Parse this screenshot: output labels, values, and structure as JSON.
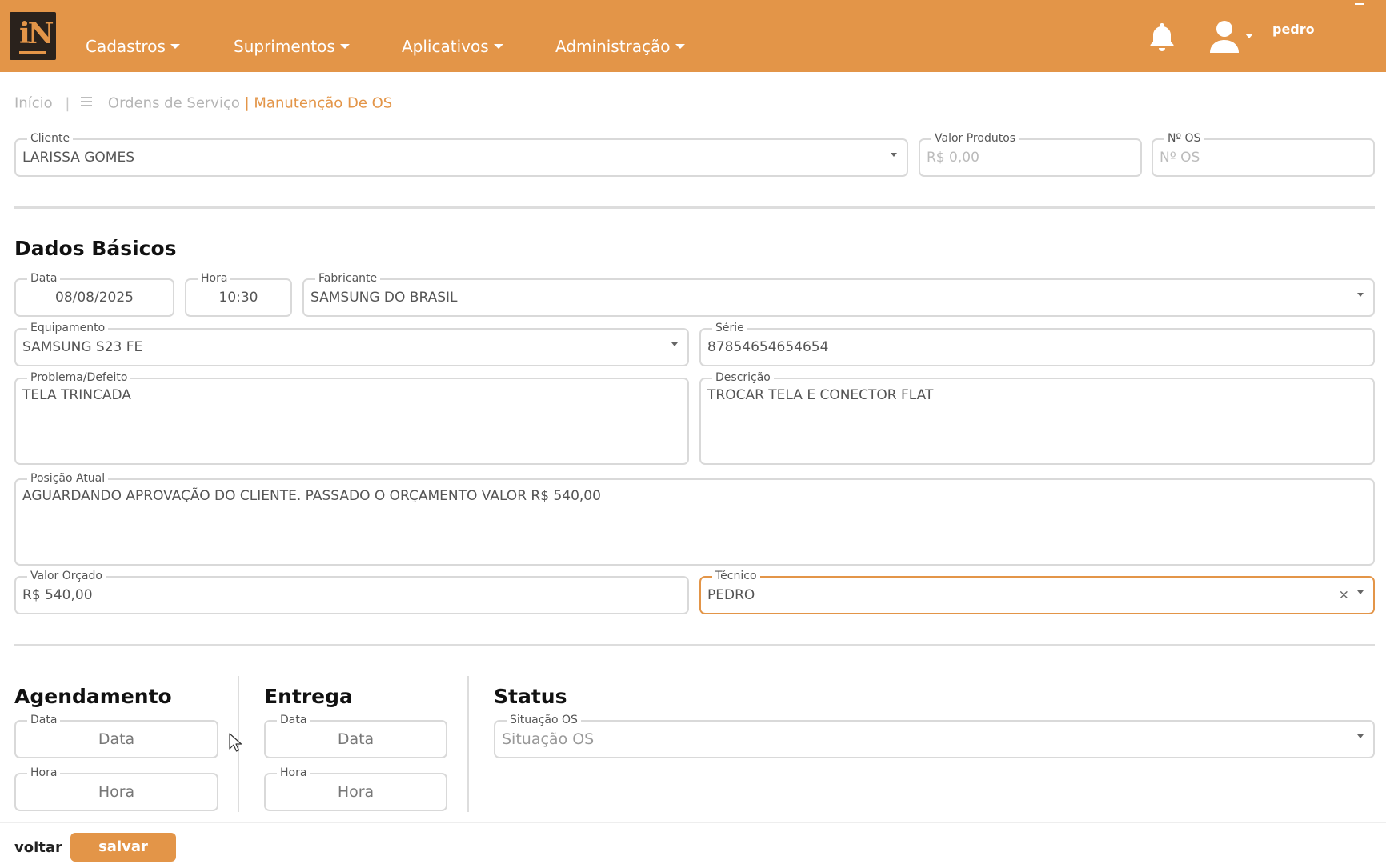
{
  "navbar": {
    "logo_text": "iN",
    "menu": [
      {
        "label": "Cadastros"
      },
      {
        "label": "Suprimentos"
      },
      {
        "label": "Aplicativos"
      },
      {
        "label": "Administração"
      }
    ],
    "username": "pedro",
    "accent_color": "#e39548"
  },
  "breadcrumb": {
    "home": "Início",
    "separator": "|",
    "list": "Ordens de Serviço",
    "current": "| Manutenção De OS"
  },
  "header_fields": {
    "cliente": {
      "label": "Cliente",
      "value": "LARISSA GOMES"
    },
    "valor_produtos": {
      "label": "Valor Produtos",
      "placeholder": "R$ 0,00"
    },
    "numero_os": {
      "label": "Nº OS",
      "placeholder": "Nº OS"
    }
  },
  "dados_basicos": {
    "title": "Dados Básicos",
    "data": {
      "label": "Data",
      "value": "08/08/2025"
    },
    "hora": {
      "label": "Hora",
      "value": "10:30"
    },
    "fabricante": {
      "label": "Fabricante",
      "value": "SAMSUNG DO BRASIL"
    },
    "equipamento": {
      "label": "Equipamento",
      "value": "SAMSUNG S23 FE"
    },
    "serie": {
      "label": "Série",
      "value": "87854654654654"
    },
    "problema": {
      "label": "Problema/Defeito",
      "value": "TELA TRINCADA"
    },
    "descricao": {
      "label": "Descrição",
      "value": "TROCAR TELA E CONECTOR FLAT"
    },
    "posicao_atual": {
      "label": "Posição Atual",
      "value": "AGUARDANDO APROVAÇÃO DO CLIENTE. PASSADO O ORÇAMENTO VALOR R$ 540,00"
    },
    "valor_orcado": {
      "label": "Valor Orçado",
      "value": "R$ 540,00"
    },
    "tecnico": {
      "label": "Técnico",
      "value": "PEDRO",
      "clear": "×"
    }
  },
  "agendamento": {
    "title": "Agendamento",
    "data": {
      "label": "Data",
      "placeholder": "Data"
    },
    "hora": {
      "label": "Hora",
      "placeholder": "Hora"
    }
  },
  "entrega": {
    "title": "Entrega",
    "data": {
      "label": "Data",
      "placeholder": "Data"
    },
    "hora": {
      "label": "Hora",
      "placeholder": "Hora"
    }
  },
  "status": {
    "title": "Status",
    "situacao": {
      "label": "Situação OS",
      "placeholder": "Situação OS"
    }
  },
  "actions": {
    "back_label": "voltar",
    "save_label": "salvar"
  }
}
